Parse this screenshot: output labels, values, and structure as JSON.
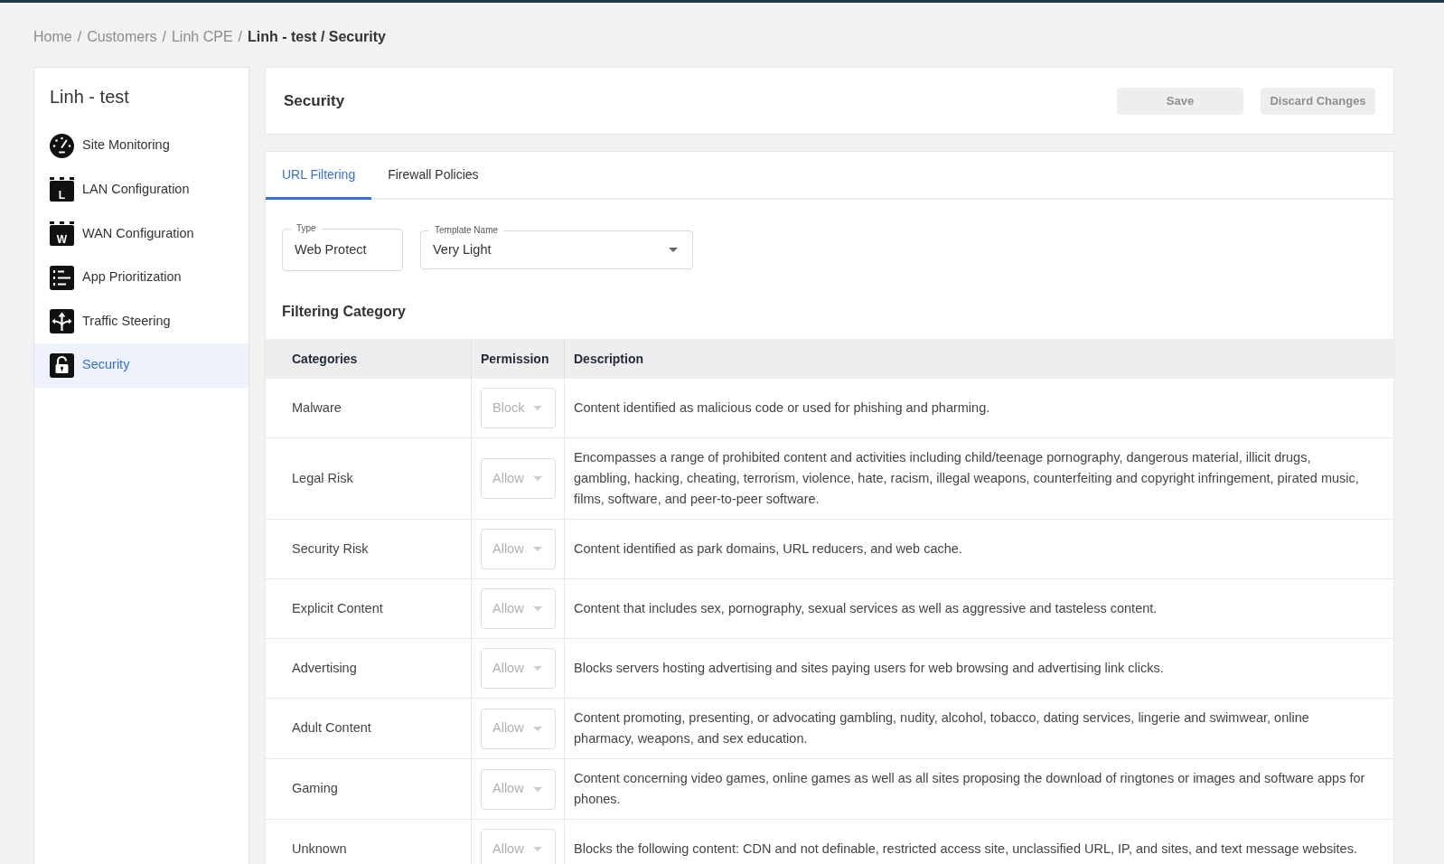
{
  "breadcrumb": {
    "links": [
      "Home",
      "Customers",
      "Linh CPE"
    ],
    "separator": "/",
    "current": "Linh - test / Security"
  },
  "sidebar": {
    "title": "Linh - test",
    "items": [
      {
        "label": "Site Monitoring",
        "kind": "gauge",
        "selected": false
      },
      {
        "label": "LAN Configuration",
        "kind": "letter-box",
        "letter": "L",
        "selected": false
      },
      {
        "label": "WAN Configuration",
        "kind": "letter-box",
        "letter": "W",
        "selected": false
      },
      {
        "label": "App Prioritization",
        "kind": "list",
        "selected": false
      },
      {
        "label": "Traffic Steering",
        "kind": "arrows",
        "selected": false
      },
      {
        "label": "Security",
        "kind": "lock",
        "selected": true
      }
    ]
  },
  "header": {
    "title": "Security",
    "buttons": [
      {
        "label": "Save",
        "disabled": true
      },
      {
        "label": "Discard Changes",
        "disabled": true
      }
    ]
  },
  "tabs": [
    {
      "label": "URL Filtering",
      "selected": true
    },
    {
      "label": "Firewall Policies",
      "selected": false
    }
  ],
  "fields": [
    {
      "kind": "text",
      "label": "Type",
      "value": "Web Protect"
    },
    {
      "kind": "select",
      "label": "Template Name",
      "value": "Very Light"
    }
  ],
  "section_title": "Filtering Category",
  "table": {
    "columns": [
      "Categories",
      "Permission",
      "Description"
    ],
    "rows": [
      {
        "category": "Malware",
        "permission": "Block",
        "disabled": true,
        "description": "Content identified as malicious code or used for phishing and pharming."
      },
      {
        "category": "Legal Risk",
        "permission": "Allow",
        "disabled": true,
        "description": "Encompasses a range of prohibited content and activities including child/teenage pornography, dangerous material, illicit drugs, gambling, hacking, cheating, terrorism, violence, hate, racism, illegal weapons, counterfeiting and copyright infringement, pirated music, films, software, and peer-to-peer software."
      },
      {
        "category": "Security Risk",
        "permission": "Allow",
        "disabled": true,
        "description": "Content identified as park domains, URL reducers, and web cache."
      },
      {
        "category": "Explicit Content",
        "permission": "Allow",
        "disabled": true,
        "description": "Content that includes sex, pornography, sexual services as well as aggressive and tasteless content."
      },
      {
        "category": "Advertising",
        "permission": "Allow",
        "disabled": true,
        "description": "Blocks servers hosting advertising and sites paying users for web browsing and advertising link clicks."
      },
      {
        "category": "Adult Content",
        "permission": "Allow",
        "disabled": true,
        "description": "Content promoting, presenting, or advocating gambling, nudity, alcohol, tobacco, dating services, lingerie and swimwear, online pharmacy, weapons, and sex education."
      },
      {
        "category": "Gaming",
        "permission": "Allow",
        "disabled": true,
        "description": "Content concerning video games, online games as well as all sites proposing the download of ringtones or images and software apps for phones."
      },
      {
        "category": "Unknown",
        "permission": "Allow",
        "disabled": true,
        "description": "Blocks the following content: CDN and not definable, restricted access site, unclassified URL, IP, and sites, and text message websites."
      }
    ]
  }
}
